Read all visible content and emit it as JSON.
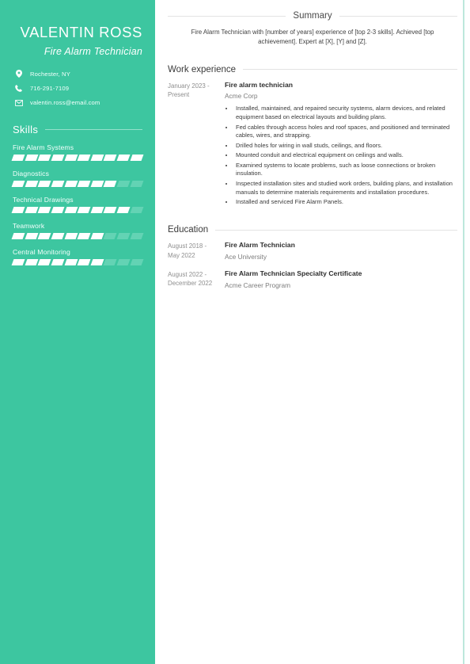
{
  "sidebar": {
    "name": "VALENTIN ROSS",
    "job_title": "Fire Alarm Technician",
    "contacts": [
      {
        "icon": "location-pin-icon",
        "text": "Rochester, NY"
      },
      {
        "icon": "phone-icon",
        "text": "716-291-7109"
      },
      {
        "icon": "envelope-icon",
        "text": "valentin.ross@email.com"
      }
    ],
    "skills_heading": "Skills",
    "skills": [
      {
        "name": "Fire Alarm Systems",
        "filled": 10,
        "total": 10
      },
      {
        "name": "Diagnostics",
        "filled": 8,
        "total": 10
      },
      {
        "name": "Technical Drawings",
        "filled": 9,
        "total": 10
      },
      {
        "name": "Teamwork",
        "filled": 7,
        "total": 10
      },
      {
        "name": "Central Monitoring",
        "filled": 7,
        "total": 10
      }
    ],
    "accent_color": "#3dc6a0",
    "segment_off_color": "#63d3b4"
  },
  "main": {
    "summary": {
      "heading": "Summary",
      "text": "Fire Alarm Technician with [number of years] experience of [top 2-3 skills]. Achieved [top achievement]. Expert at [X], [Y] and [Z]."
    },
    "work": {
      "heading": "Work experience",
      "entries": [
        {
          "date": "January 2023 - Present",
          "role": "Fire alarm technician",
          "org": "Acme Corp",
          "bullets": [
            "Installed, maintained, and repaired security systems, alarm devices, and related equipment based on electrical layouts and building plans.",
            "Fed cables through access holes and roof spaces, and positioned and terminated cables, wires, and strapping.",
            "Drilled holes for wiring in wall studs, ceilings, and floors.",
            "Mounted conduit and electrical equipment on ceilings and walls.",
            "Examined systems to locate problems, such as loose connections or broken insulation.",
            "Inspected installation sites and studied work orders, building plans, and installation manuals to determine materials requirements and installation procedures.",
            "Installed and serviced Fire Alarm Panels."
          ]
        }
      ]
    },
    "education": {
      "heading": "Education",
      "entries": [
        {
          "date": "August 2018 - May 2022",
          "degree": "Fire Alarm Technician",
          "school": "Ace University"
        },
        {
          "date": "August 2022 - December 2022",
          "degree": "Fire Alarm Technician Specialty Certificate",
          "school": "Acme Career Program"
        }
      ]
    }
  }
}
